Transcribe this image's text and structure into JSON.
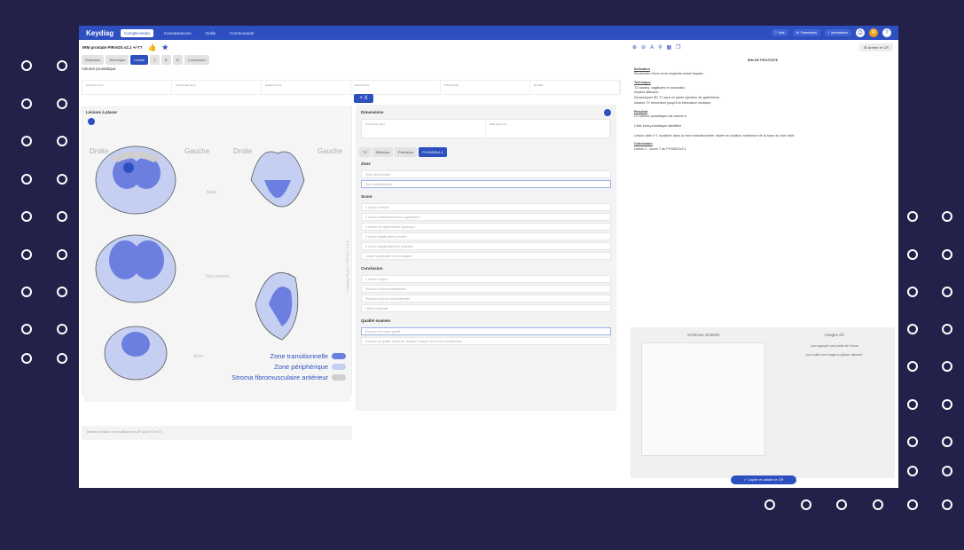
{
  "app": {
    "brand": "Keydiag",
    "nav": [
      "Compte-rendu",
      "Connaissances",
      "Outils",
      "Communauté"
    ],
    "top_buttons": [
      "Aide",
      "Paramètres",
      "Informations"
    ],
    "user_initial": "M"
  },
  "header": {
    "title": "IRM prostate PIRADS v2.1 +/-T?",
    "tabs": [
      "Indication",
      "Technique",
      "Lésion",
      "T",
      "N",
      "M",
      "Conclusion"
    ],
    "active_tab": "Lésion",
    "volume_label": "Volume prostatique"
  },
  "fields": [
    "Ant-Post (mm)",
    "Transverse (mm)",
    "Hauteur (mm)",
    "Volume (cc)",
    "PSA (ng/ml)",
    "Densité"
  ],
  "lesion_panel": {
    "title": "Lésions à placer",
    "labels": {
      "left_top": "Droite",
      "gauche_top": "Gauche",
      "right_top": "Droite",
      "gauche_right": "Gauche",
      "base": "Base",
      "mid": "Tiers moyen",
      "apex": "Apex"
    },
    "watermark": "Keydiag Pirads - IRM v2.1.4.6.X",
    "legend": [
      {
        "label": "Zone transitionnelle",
        "color": "#6c7fe0"
      },
      {
        "label": "Zone périphérique",
        "color": "#c5cff2"
      },
      {
        "label": "Stroma fibromusculaire antérieur",
        "color": "#cfcfcf"
      }
    ],
    "description_placeholder": "Décrire la lésion vue en diffusion en ZP, sur le T2 et T1"
  },
  "mid_panel": {
    "close": "X",
    "dimensions_title": "Dimensions",
    "dim_fields": [
      "Grand axe (mm)",
      "Petit axe (mm)"
    ],
    "tabs": [
      "T2",
      "Diffusion",
      "Perfusion",
      "PI-RADSv2.1"
    ],
    "active_tab": "PI-RADSv2.1",
    "zone_title": "Zone",
    "zones": [
      "Zone périphérique",
      "Zone transitionnelle"
    ],
    "score_title": "Score",
    "scores": [
      "1 Lésion normale",
      "2 Lésion probablement non significative",
      "3 Lésion de significativité équivoque",
      "4 Lésion significative probable",
      "5 Lésion significative très probable",
      "Lésion significative non évaluable"
    ],
    "conclusion_title": "Conclusion",
    "conclusions": [
      "1 Lésion unique",
      "Plusieurs lésions ipsilatérales",
      "Plusieurs lésions controlatérales",
      "Lésion bilatérale"
    ],
    "quality_title": "Qualité examen",
    "qualities": [
      "Examen de bonne qualité",
      "Examen de qualité diminuée, limitant l'analyse de la zone périphérique"
    ]
  },
  "report": {
    "toolbar_icons": [
      "zoom-in",
      "zoom-out",
      "text",
      "pin",
      "image",
      "copy"
    ],
    "stop_label": "Arrêter le CR",
    "doc_title": "IRM DE PROSTATE",
    "indication_h": "Indication",
    "indication": "Recherche d'une zone suspecte avant biopsie.",
    "technique_h": "Technique",
    "technique": [
      "T2 axiales, sagittales et coronales.",
      "Axiales diffusion.",
      "Dynamiques 3D T1 sans et après injection de gadolinium.",
      "Axiales T2 remontant jusqu'à la bifurcation aortique."
    ],
    "resultat_h": "Résultat",
    "resultat": [
      "Le volume prostatique est estimé à",
      "Cible intra-prostatique identifiée :",
      "Lésion cible n°1 localisée dans la zone transitionnelle, située en position antérieure de la base du lobe droit :"
    ],
    "conclusion_h": "Conclusion",
    "conclusion": "Lésion 1 : score 7 du PI-RADSv2.1",
    "pager": "1/1 visibles",
    "schemas_title": "Schémas d'intérêt",
    "images_title": "Images clé",
    "images_hint": "pour appuyer une partie de l'écran",
    "images_hint2": "pour coller une image ou glisser-déposer.",
    "copy_button": "Copier et valider le CR"
  }
}
